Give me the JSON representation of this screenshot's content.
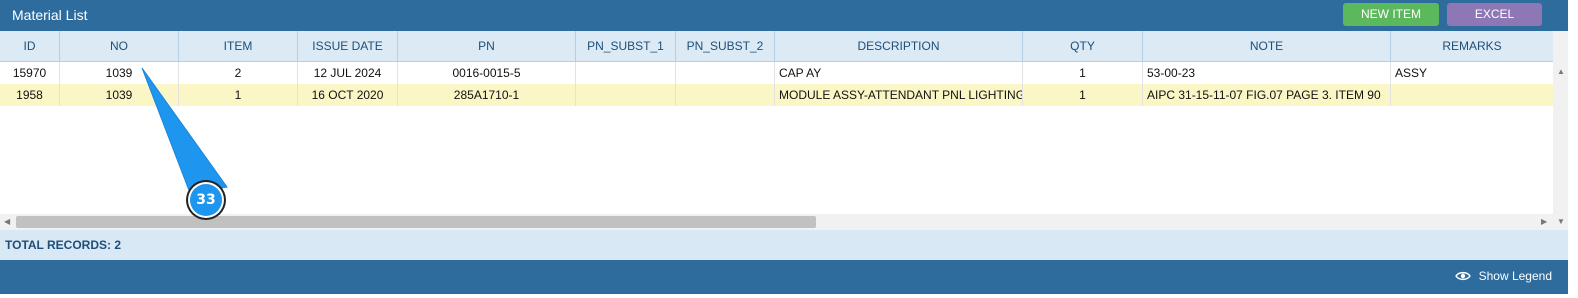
{
  "header": {
    "title": "Material List",
    "new_item_label": "NEW ITEM",
    "excel_label": "EXCEL"
  },
  "columns": [
    "ID",
    "NO",
    "ITEM",
    "ISSUE DATE",
    "PN",
    "PN_SUBST_1",
    "PN_SUBST_2",
    "DESCRIPTION",
    "QTY",
    "NOTE",
    "REMARKS"
  ],
  "rows": [
    {
      "id": "15970",
      "no": "1039",
      "item": "2",
      "issue_date": "12 JUL 2024",
      "pn": "0016-0015-5",
      "pn_subst_1": "",
      "pn_subst_2": "",
      "description": "CAP AY",
      "qty": "1",
      "note": "53-00-23",
      "remarks": "ASSY"
    },
    {
      "id": "1958",
      "no": "1039",
      "item": "1",
      "issue_date": "16 OCT 2020",
      "pn": "285A1710-1",
      "pn_subst_1": "",
      "pn_subst_2": "",
      "description": "MODULE ASSY-ATTENDANT PNL LIGHTING",
      "qty": "1",
      "note": "AIPC 31-15-11-07 FIG.07 PAGE 3. ITEM 90",
      "remarks": ""
    }
  ],
  "footer": {
    "total_records": "TOTAL RECORDS: 2",
    "show_legend": "Show Legend"
  },
  "callout": {
    "number": "33"
  },
  "colors": {
    "header_bg": "#2e6c9e",
    "grid_header_bg": "#dbeaf5",
    "selected_row_bg": "#fbf6c5",
    "new_item_bg": "#5cb85c",
    "excel_bg": "#8e77b5",
    "callout_fill": "#1e96f0"
  },
  "icons": {
    "legend": "eye-icon",
    "scroll_left": "arrow-left-icon",
    "scroll_right": "arrow-right-icon",
    "scroll_up": "arrow-up-icon",
    "scroll_down": "arrow-down-icon"
  }
}
